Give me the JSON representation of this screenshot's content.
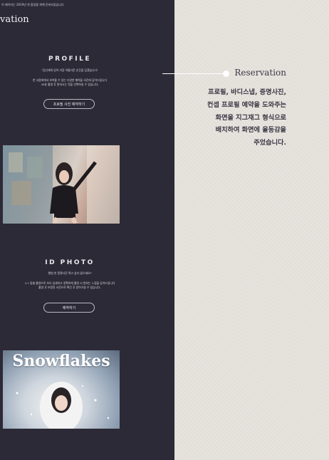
{
  "left": {
    "top_note": "이 페이지는 2019년 첫 촬영을 위해 준비되었습니다",
    "title_fragment": "vation",
    "profile": {
      "title": "PROFILE",
      "line1": "\"당신에게 있어 가장 아름다운 순간을 담겠습니다\"",
      "line2": "한 사람에게서 보여줄 수 있는 다양한 매력을 사진에 담아드립니다",
      "line3": "30분 촬영 후 원하시는 컷을 선택하실 수 있습니다.",
      "button": "프로필 사진 예약하기"
    },
    "id_photo": {
      "title": "ID PHOTO",
      "line1": "'평범 한 증명사진 찍고 싶지 않으세요?'",
      "line2": "1:1 맞춤 촬영으로 보다 섬세하고 정확하게 촬영 시 원하는 느낌을 담아드립니다",
      "line3": "촬영 후 보정된 사진으로 확인 후 받아가실 수 있습니다.",
      "button": "예약하기"
    },
    "photo2_overlay": "Snowflakes"
  },
  "right": {
    "label": "Reservation",
    "description": [
      "프로필, 바디스냅, 증명사진,",
      "컨셉 프로필 예약을 도와주는",
      "화면을  지그재그 형식으로",
      "배치하여 화면에 율동감을",
      "주었습니다."
    ]
  },
  "colors": {
    "dark_panel": "#2c2a36",
    "light_panel": "#e6e2dc",
    "text_dark": "#3b3946"
  }
}
